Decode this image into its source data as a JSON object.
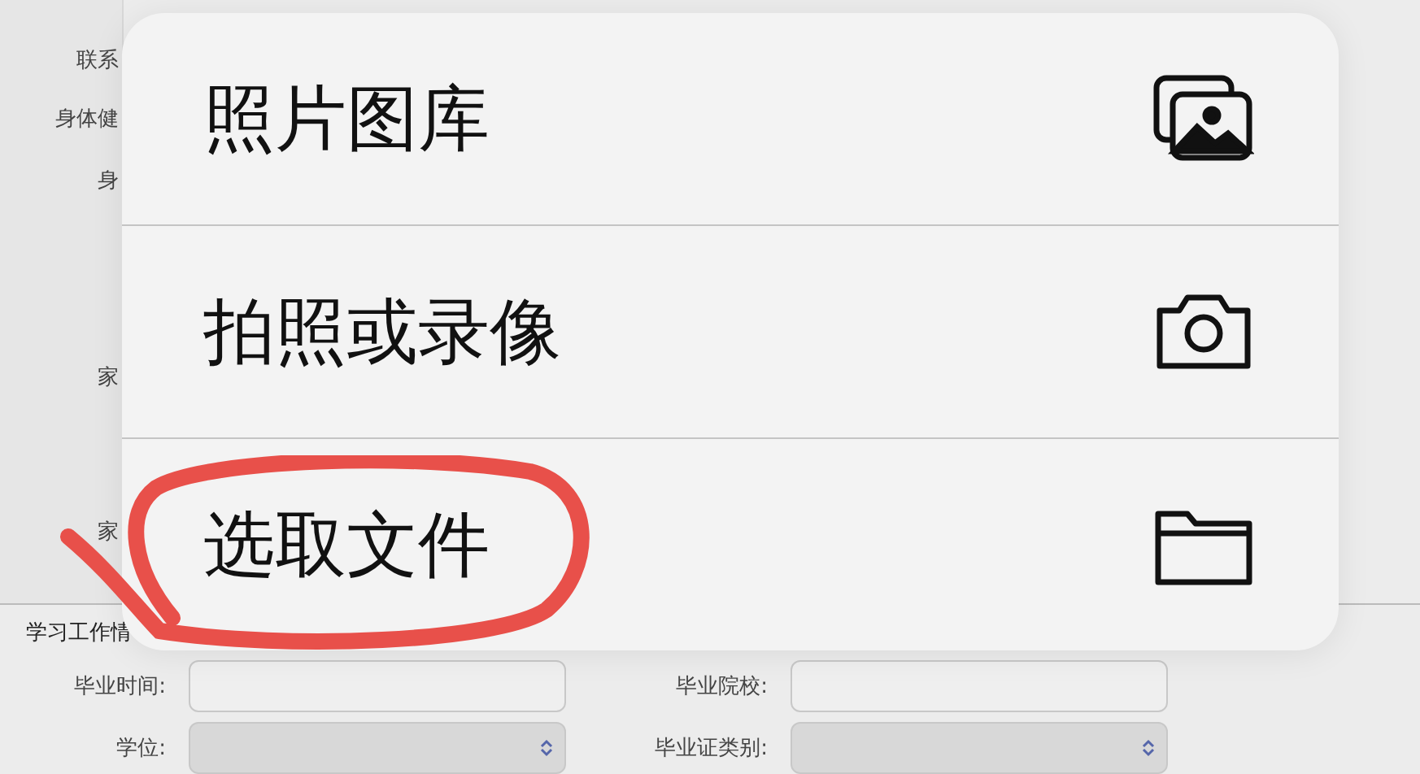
{
  "form": {
    "labels": [
      "联系",
      "身体健",
      "身",
      "家",
      "家"
    ],
    "section": {
      "legend": "学习工作情",
      "rows": [
        {
          "kind": "input",
          "label": "毕业时间:"
        },
        {
          "kind": "input",
          "label": "毕业院校:"
        },
        {
          "kind": "select",
          "label": "学位:"
        },
        {
          "kind": "select",
          "label": "毕业证类别:"
        }
      ]
    }
  },
  "action_menu": {
    "items": [
      {
        "label": "照片图库",
        "kind": "photos"
      },
      {
        "label": "拍照或录像",
        "kind": "camera"
      },
      {
        "label": "选取文件",
        "kind": "folder",
        "circled": true
      }
    ]
  }
}
